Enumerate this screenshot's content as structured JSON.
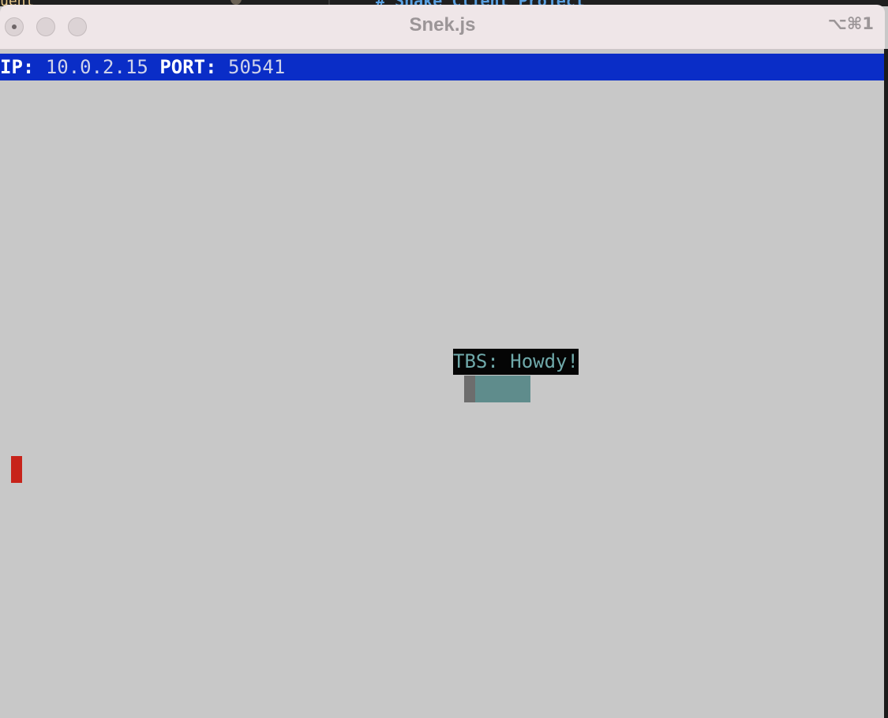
{
  "background_window": {
    "left_text": "uent",
    "code_text": "# Snake Client Project"
  },
  "window": {
    "title": "Snek.js",
    "shortcut": "⌥⌘1"
  },
  "status": {
    "ip_label": "IP:",
    "ip_value": "10.0.2.15",
    "port_label": "PORT:",
    "port_value": "50541"
  },
  "game": {
    "chat_message": "TBS: Howdy!",
    "colors": {
      "board": "#c8c8c8",
      "status_bar": "#0a2dc7",
      "snake_head": "#6d6d6d",
      "snake_body": "#5f8c8c",
      "food": "#c7231a",
      "chat_bg": "#050505",
      "chat_text": "#6fa9aa"
    }
  }
}
